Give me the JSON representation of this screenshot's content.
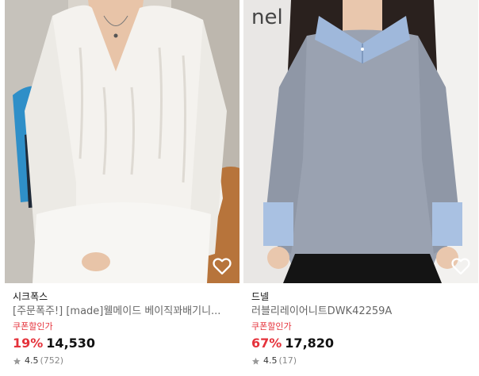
{
  "products": [
    {
      "seller": "시크폭스",
      "title": "[주문폭주!] [made]웰메이드 베이직꽈배기니...",
      "coupon": "쿠폰할인가",
      "discount": "19%",
      "price": "14,530",
      "rating": "4.5",
      "review_count": "(752)",
      "wish_icon": "heart-outline-icon"
    },
    {
      "seller": "드넬",
      "title": "러블리레이어니트DWK42259A",
      "coupon": "쿠폰할인가",
      "discount": "67%",
      "price": "17,820",
      "rating": "4.5",
      "review_count": "(17)",
      "wish_icon": "heart-outline-icon"
    }
  ],
  "colors": {
    "discount": "#e5323b",
    "coupon": "#e5323b",
    "star": "#9a9a9a"
  }
}
